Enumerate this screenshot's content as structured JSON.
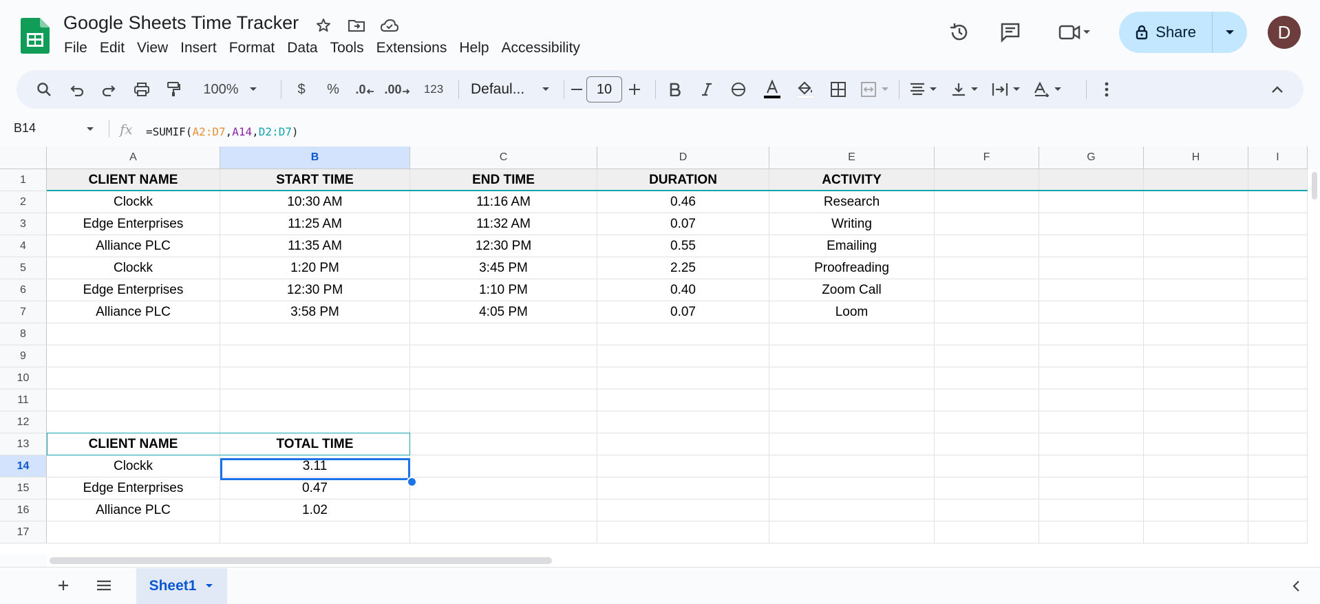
{
  "app": {
    "doc_title": "Google Sheets Time Tracker",
    "menu": [
      "File",
      "Edit",
      "View",
      "Insert",
      "Format",
      "Data",
      "Tools",
      "Extensions",
      "Help",
      "Accessibility"
    ],
    "share_label": "Share",
    "avatar_initial": "D"
  },
  "toolbar": {
    "zoom": "100%",
    "currency": "$",
    "percent": "%",
    "decrease_decimal": ".0",
    "increase_decimal": ".00",
    "number_format": "123",
    "font": "Defaul...",
    "font_size": "10"
  },
  "formula_bar": {
    "name_box": "B14",
    "fx": "fx",
    "formula_prefix": "=SUMIF(",
    "arg1": "A2:D7",
    "comma1": ",",
    "arg2": "A14",
    "comma2": ",",
    "arg3": "D2:D7",
    "formula_suffix": ")"
  },
  "grid": {
    "columns": [
      "A",
      "B",
      "C",
      "D",
      "E",
      "F",
      "G",
      "H",
      "I"
    ],
    "rows": [
      "1",
      "2",
      "3",
      "4",
      "5",
      "6",
      "7",
      "8",
      "9",
      "10",
      "11",
      "12",
      "13",
      "14",
      "15",
      "16",
      "17"
    ],
    "selected_cell": "B14",
    "table1": {
      "headers": [
        "CLIENT NAME",
        "START TIME",
        "END TIME",
        "DURATION",
        "ACTIVITY"
      ],
      "rows": [
        [
          "Clockk",
          "10:30 AM",
          "11:16 AM",
          "0.46",
          "Research"
        ],
        [
          "Edge Enterprises",
          "11:25 AM",
          "11:32 AM",
          "0.07",
          "Writing"
        ],
        [
          "Alliance PLC",
          "11:35 AM",
          "12:30 PM",
          "0.55",
          "Emailing"
        ],
        [
          "Clockk",
          "1:20 PM",
          "3:45 PM",
          "2.25",
          "Proofreading"
        ],
        [
          "Edge Enterprises",
          "12:30 PM",
          "1:10 PM",
          "0.40",
          "Zoom Call"
        ],
        [
          "Alliance PLC",
          "3:58 PM",
          "4:05 PM",
          "0.07",
          "Loom"
        ]
      ]
    },
    "table2": {
      "headers": [
        "CLIENT NAME",
        "TOTAL TIME"
      ],
      "rows": [
        [
          "Clockk",
          "3.11"
        ],
        [
          "Edge Enterprises",
          "0.47"
        ],
        [
          "Alliance PLC",
          "1.02"
        ]
      ]
    }
  },
  "sheets": {
    "active": "Sheet1"
  },
  "colors": {
    "accent": "#0b57d0",
    "share_bg": "#c2e7ff",
    "selection": "#1a73e8",
    "header_fill": "#efefef"
  }
}
